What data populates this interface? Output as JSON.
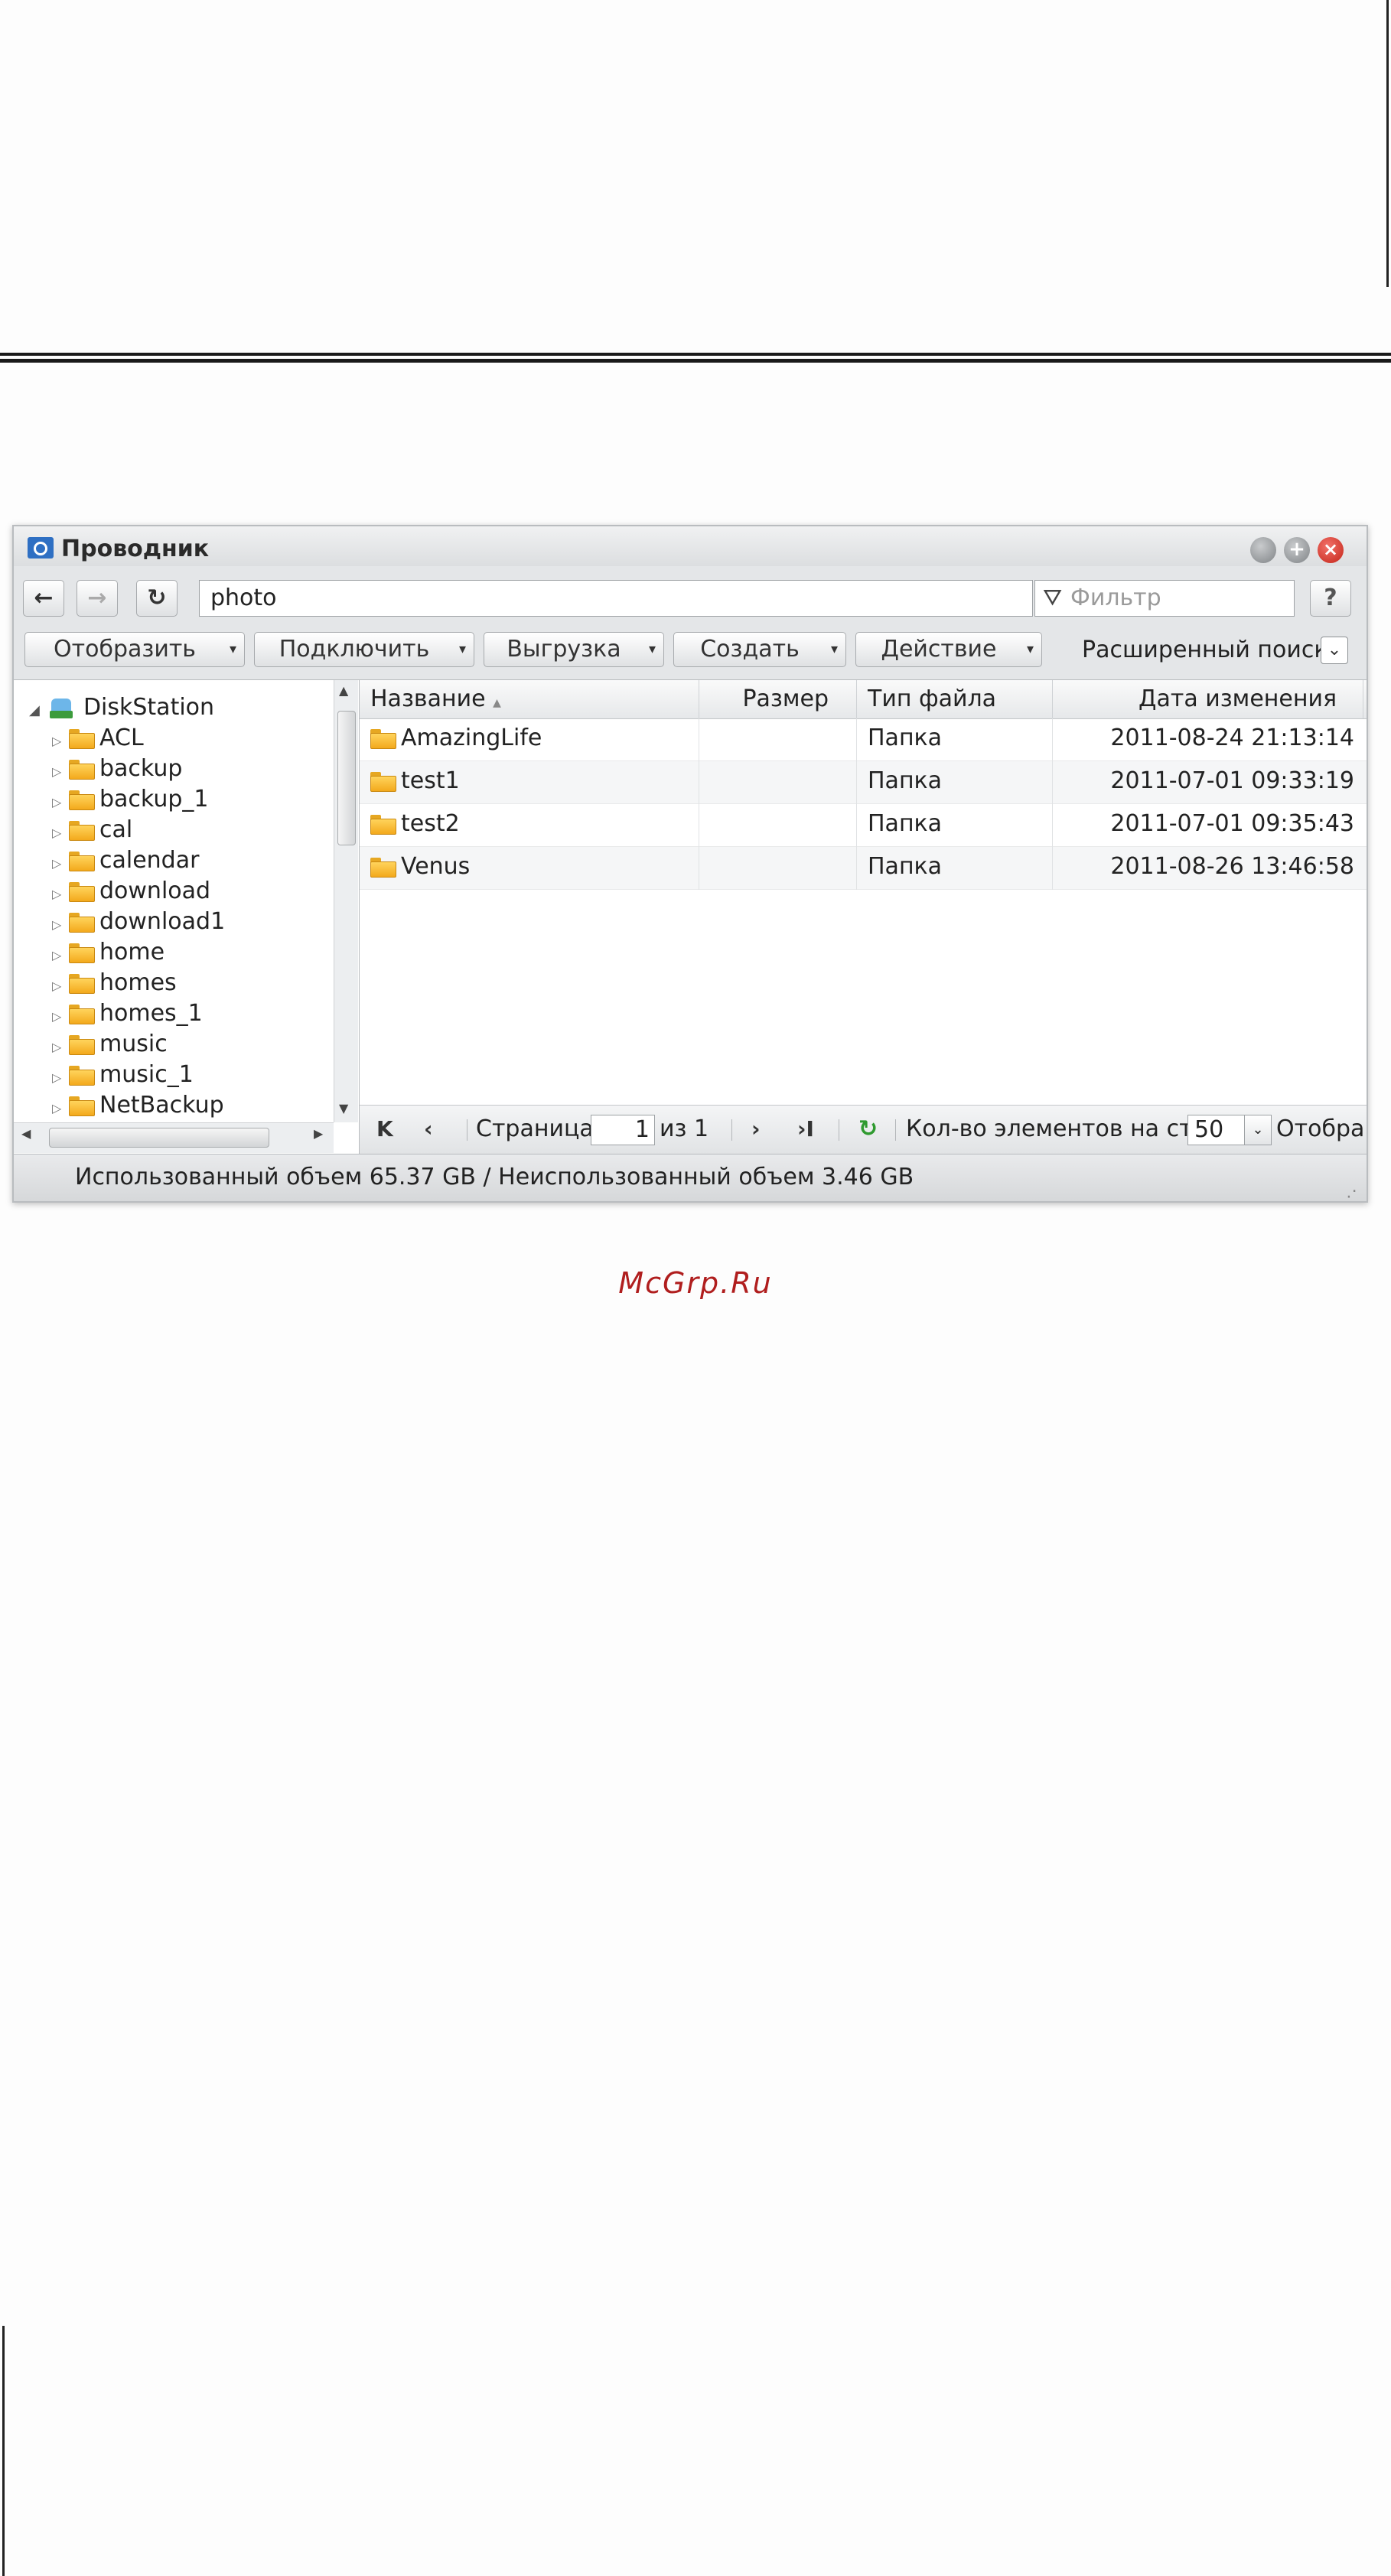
{
  "window": {
    "title": "Проводник",
    "controls": {
      "maximize_glyph": "+",
      "close_glyph": "×"
    }
  },
  "nav": {
    "back_glyph": "←",
    "forward_glyph": "→",
    "refresh_glyph": "↻",
    "path": "photo",
    "filter_placeholder": "Фильтр",
    "filter_icon_glyph": "⛛",
    "help_label": "?"
  },
  "toolbar": {
    "buttons": [
      {
        "label": "Отобразить"
      },
      {
        "label": "Подключить"
      },
      {
        "label": "Выгрузка"
      },
      {
        "label": "Создать"
      },
      {
        "label": "Действие"
      }
    ],
    "caret": "▾",
    "advanced_search": "Расширенный поиск",
    "advanced_toggle": "⌄"
  },
  "tree": {
    "root": "DiskStation",
    "expanded_arrow": "◢",
    "collapsed_arrow": "▷",
    "items": [
      {
        "label": "ACL"
      },
      {
        "label": "backup"
      },
      {
        "label": "backup_1"
      },
      {
        "label": "cal"
      },
      {
        "label": "calendar"
      },
      {
        "label": "download"
      },
      {
        "label": "download1"
      },
      {
        "label": "home"
      },
      {
        "label": "homes"
      },
      {
        "label": "homes_1"
      },
      {
        "label": "music"
      },
      {
        "label": "music_1"
      },
      {
        "label": "NetBackup"
      }
    ],
    "scroll_glyphs": {
      "up": "▲",
      "down": "▼",
      "left": "◀",
      "right": "▶"
    }
  },
  "grid": {
    "columns": [
      "Название",
      "Размер",
      "Тип файла",
      "Дата изменения"
    ],
    "sort_indicator": "▲",
    "rows": [
      {
        "name": "AmazingLife",
        "size": "",
        "type": "Папка",
        "modified": "2011-08-24 21:13:14"
      },
      {
        "name": "test1",
        "size": "",
        "type": "Папка",
        "modified": "2011-07-01 09:33:19"
      },
      {
        "name": "test2",
        "size": "",
        "type": "Папка",
        "modified": "2011-07-01 09:35:43"
      },
      {
        "name": "Venus",
        "size": "",
        "type": "Папка",
        "modified": "2011-08-26 13:46:58"
      }
    ]
  },
  "pager": {
    "first": "K",
    "prev": "‹",
    "page_label": "Страница",
    "page_value": "1",
    "of_label": "из 1",
    "next": "›",
    "last": "›I",
    "refresh": "↻",
    "per_page_label": "Кол-во элементов на стр.",
    "per_page_value": "50",
    "per_page_dropdown": "⌄",
    "display_label": "Отобра"
  },
  "status": {
    "text": "Использованный объем 65.37 GB / Неиспользованный объем 3.46 GB"
  },
  "watermark": "McGrp.Ru",
  "colors": {
    "close_red": "#c42418",
    "folder_yellow": "#f3a91c",
    "refresh_green": "#2f9a2f",
    "watermark_red": "#b01e1e"
  }
}
